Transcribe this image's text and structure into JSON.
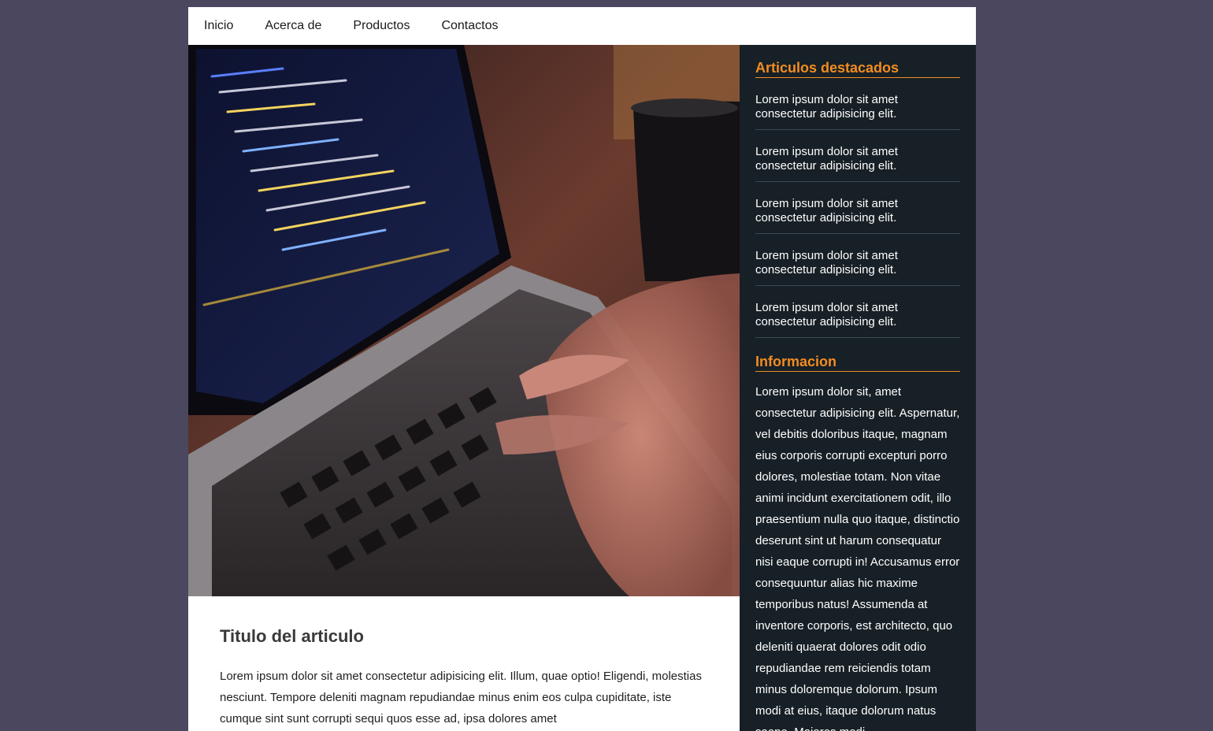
{
  "nav": {
    "items": [
      "Inicio",
      "Acerca de",
      "Productos",
      "Contactos"
    ]
  },
  "hero": {
    "icon": "laptop-coding-photo"
  },
  "article": {
    "title": "Titulo del articulo",
    "body": "Lorem ipsum dolor sit amet consectetur adipisicing elit. Illum, quae optio! Eligendi, molestias nesciunt. Tempore deleniti magnam repudiandae minus enim eos culpa cupiditate, iste cumque sint sunt corrupti sequi quos esse ad, ipsa dolores amet"
  },
  "sidebar": {
    "featured_title": "Articulos destacados",
    "featured_items": [
      "Lorem ipsum dolor sit amet consectetur adipisicing elit.",
      "Lorem ipsum dolor sit amet consectetur adipisicing elit.",
      "Lorem ipsum dolor sit amet consectetur adipisicing elit.",
      "Lorem ipsum dolor sit amet consectetur adipisicing elit.",
      "Lorem ipsum dolor sit amet consectetur adipisicing elit."
    ],
    "info_title": "Informacion",
    "info_text": "Lorem ipsum dolor sit, amet consectetur adipisicing elit. Aspernatur, vel debitis doloribus itaque, magnam eius corporis corrupti excepturi porro dolores, molestiae totam. Non vitae animi incidunt exercitationem odit, illo praesentium nulla quo itaque, distinctio deserunt sint ut harum consequatur nisi eaque corrupti in! Accusamus error consequuntur alias hic maxime temporibus natus! Assumenda at inventore corporis, est architecto, quo deleniti quaerat dolores odit odio repudiandae rem reiciendis totam minus doloremque dolorum. Ipsum modi at eius, itaque dolorum natus saepe. Maiores modi"
  },
  "colors": {
    "background": "#4b475f",
    "accent": "#f28c21",
    "sidebar_bg": "#172026"
  }
}
